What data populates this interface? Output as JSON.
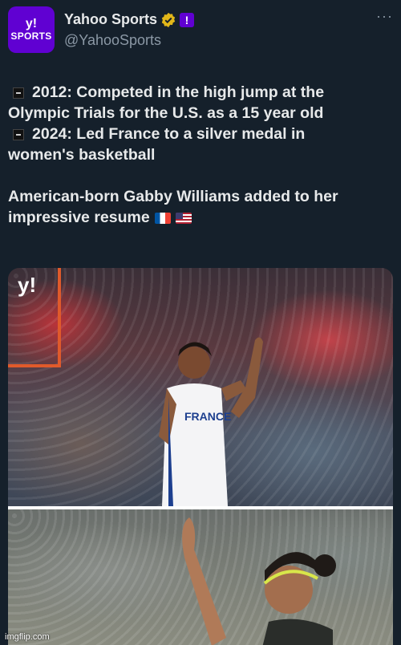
{
  "account": {
    "avatar_logo": "y!",
    "avatar_text": "SPORTS",
    "display_name": "Yahoo Sports",
    "handle": "@YahooSports",
    "verified_icon": "gold-check-badge-icon",
    "affiliate_badge": "!",
    "more_icon": "···"
  },
  "tweet": {
    "lines": [
      "2012: Competed in the high jump at the",
      "Olympic Trials for the U.S. as a 15 year old",
      "2024: Led France to a silver medal in",
      "women's basketball",
      "American-born Gabby Williams added to her",
      "impressive resume"
    ],
    "flags": [
      "flag-france-icon",
      "flag-usa-icon"
    ]
  },
  "media": {
    "photo_logo": "y!",
    "jersey_text": "FRANCE"
  },
  "watermark": "imgflip.com",
  "colors": {
    "background": "#15202b",
    "text": "#e7e9ea",
    "muted": "#8b98a5",
    "brand": "#6001d2",
    "verified": "#e2b719"
  }
}
